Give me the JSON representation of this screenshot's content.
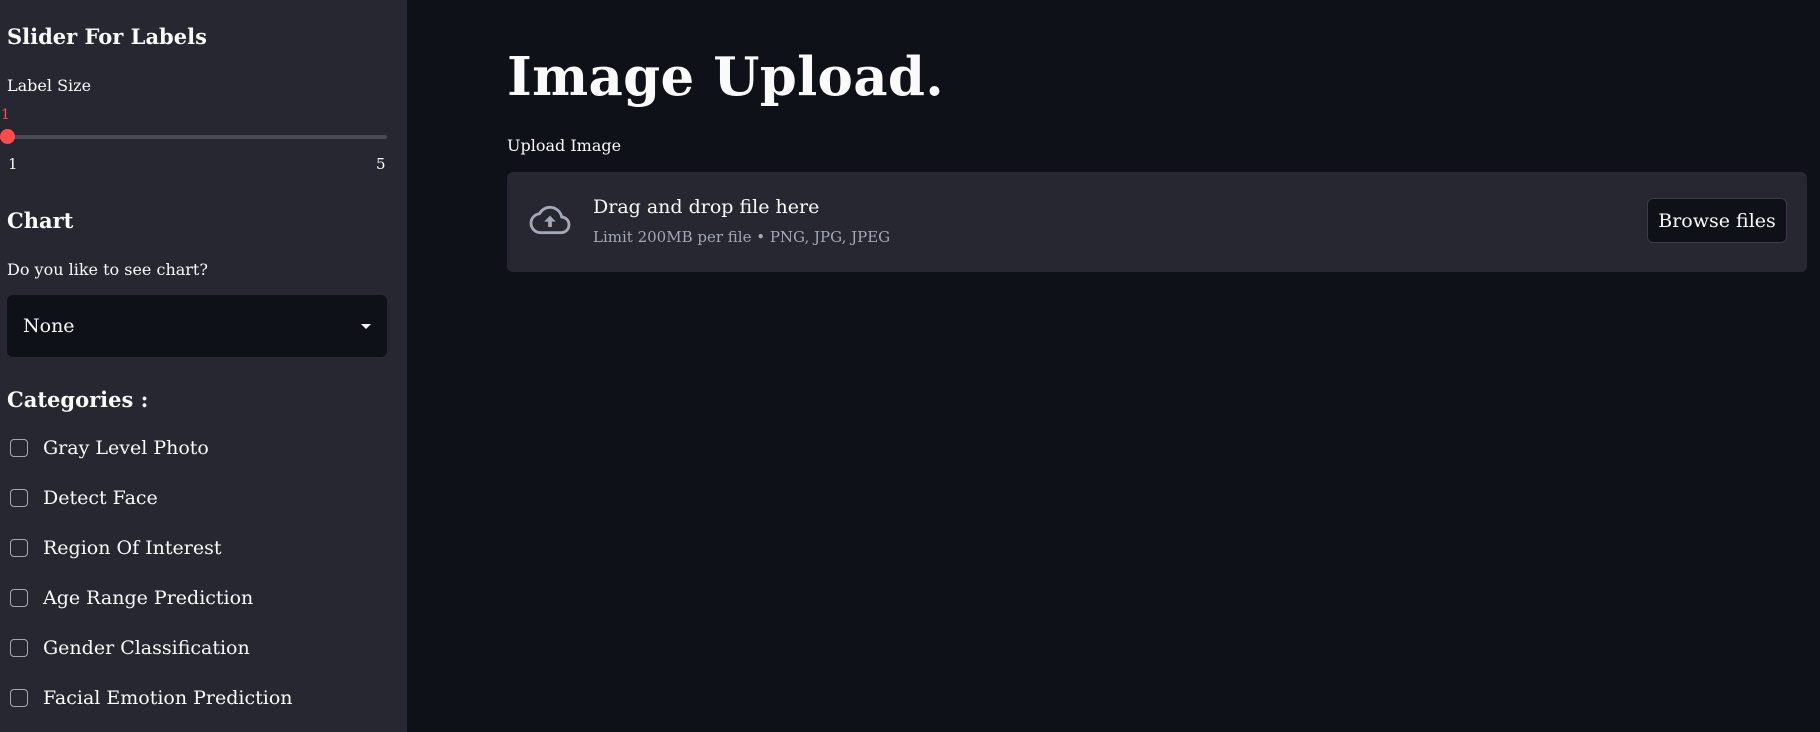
{
  "sidebar": {
    "slider_heading": "Slider For Labels",
    "slider_label": "Label Size",
    "slider": {
      "value": "1",
      "min": "1",
      "max": "5"
    },
    "chart_heading": "Chart",
    "chart_question": "Do you like to see chart?",
    "chart_select_value": "None",
    "categories_heading": "Categories :",
    "categories": [
      {
        "label": "Gray Level Photo",
        "checked": false
      },
      {
        "label": "Detect Face",
        "checked": false
      },
      {
        "label": "Region Of Interest",
        "checked": false
      },
      {
        "label": "Age Range Prediction",
        "checked": false
      },
      {
        "label": "Gender Classification",
        "checked": false
      },
      {
        "label": "Facial Emotion Prediction",
        "checked": false
      }
    ]
  },
  "main": {
    "title": "Image Upload.",
    "upload_label": "Upload Image",
    "dropzone": {
      "icon": "cloud-upload-icon",
      "title": "Drag and drop file here",
      "subtitle": "Limit 200MB per file • PNG, JPG, JPEG",
      "browse_label": "Browse files"
    }
  },
  "colors": {
    "background": "#0e1117",
    "sidebar": "#262730",
    "accent": "#ff4b4b",
    "muted_text": "#a3a8b8"
  }
}
